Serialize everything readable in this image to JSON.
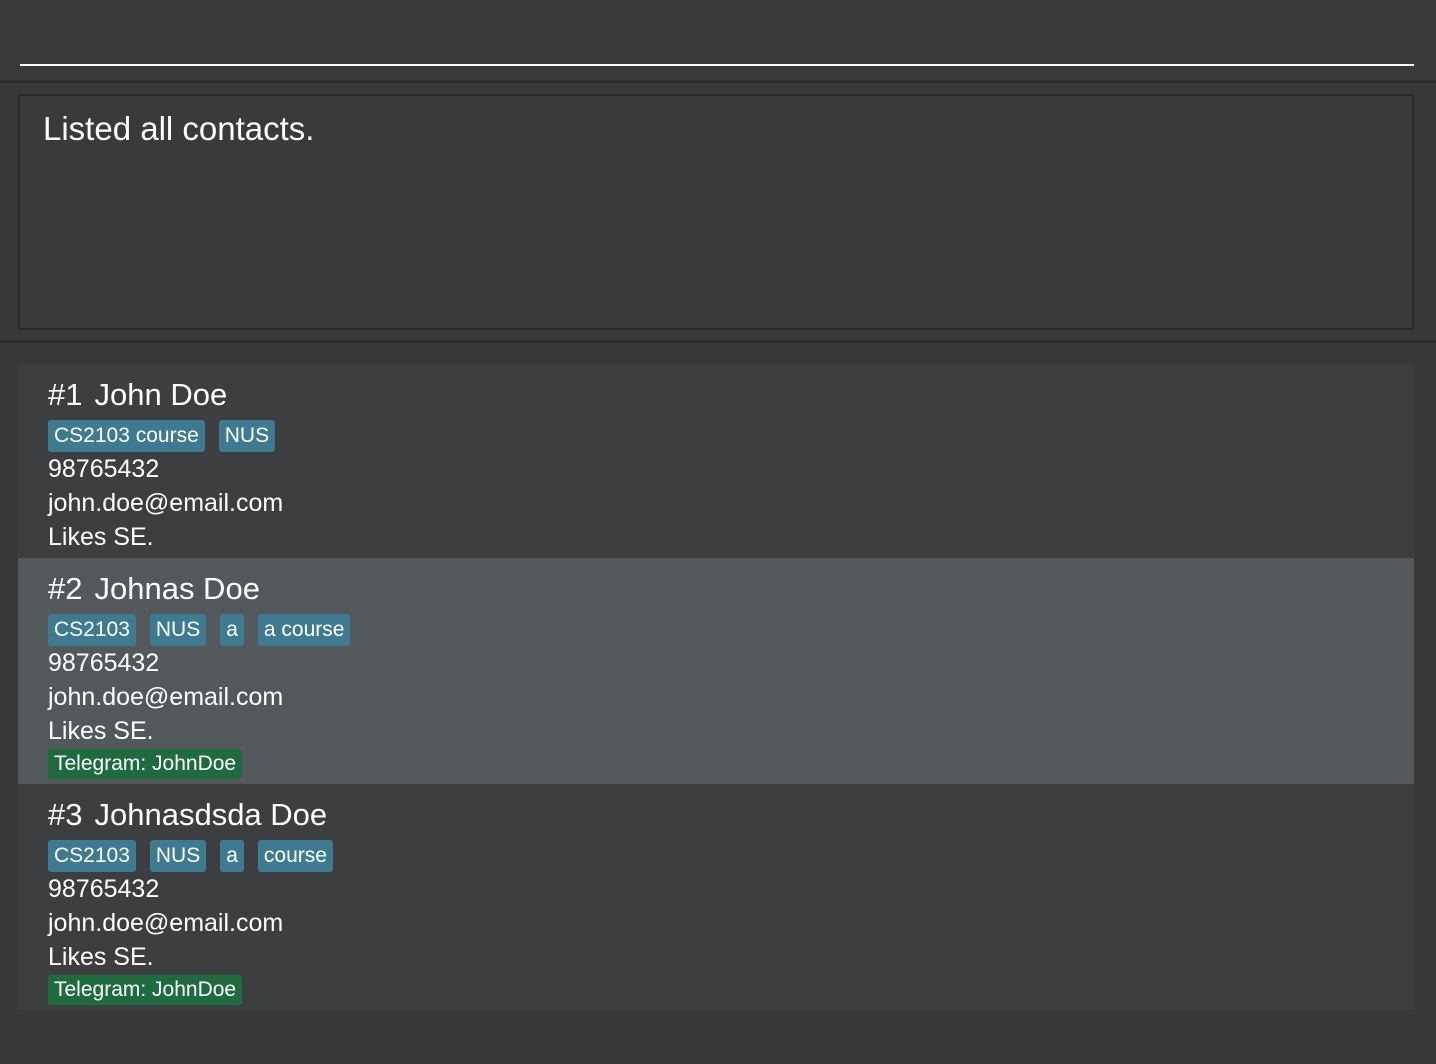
{
  "command_box": {
    "value": "",
    "placeholder": ""
  },
  "result_display": {
    "text": "Listed all contacts."
  },
  "colors": {
    "background": "#383838",
    "card": "#3c3e3f",
    "card_selected": "#53585b",
    "tag": "#3e7b91",
    "telegram_tag": "#1d6b3f"
  },
  "contacts": [
    {
      "index": "#1",
      "name": "John Doe",
      "tags": [
        "CS2103 course",
        "NUS"
      ],
      "phone": "98765432",
      "email": "john.doe@email.com",
      "remark": "Likes SE.",
      "telegram": ""
    },
    {
      "index": "#2",
      "name": "Johnas Doe",
      "tags": [
        "CS2103",
        "NUS",
        "a",
        "a course"
      ],
      "phone": "98765432",
      "email": "john.doe@email.com",
      "remark": "Likes SE.",
      "telegram": "Telegram: JohnDoe",
      "selected": true
    },
    {
      "index": "#3",
      "name": "Johnasdsda Doe",
      "tags": [
        "CS2103",
        "NUS",
        "a",
        "course"
      ],
      "phone": "98765432",
      "email": "john.doe@email.com",
      "remark": "Likes SE.",
      "telegram": "Telegram: JohnDoe"
    }
  ]
}
